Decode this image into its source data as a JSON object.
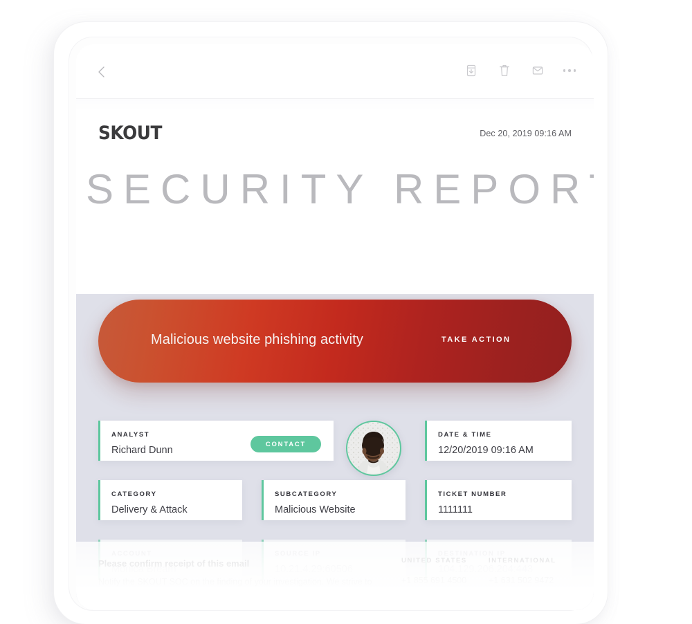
{
  "toolbar": {
    "back_icon": "chevron-left-icon",
    "actions": [
      {
        "icon": "archive-icon",
        "label": "Archive"
      },
      {
        "icon": "trash-icon",
        "label": "Delete"
      },
      {
        "icon": "envelope-icon",
        "label": "Mark as unread"
      },
      {
        "icon": "ellipsis-icon",
        "label": "More"
      }
    ]
  },
  "brand": {
    "logo_text": "SKOUT",
    "timestamp": "Dec 20, 2019 09:16 AM"
  },
  "report": {
    "title": "SECURITY REPORT"
  },
  "alert": {
    "message": "Malicious website phishing activity",
    "cta_label": "TAKE ACTION",
    "gradient_start": "#c65a3a",
    "gradient_mid": "#c32a1e",
    "gradient_end": "#93201f"
  },
  "accent": {
    "green": "#5ec79e",
    "page_background": "#dfe0e9"
  },
  "cards": {
    "analyst": {
      "label": "ANALYST",
      "value": "Richard Dunn",
      "button": "CONTACT"
    },
    "datetime": {
      "label": "DATE & TIME",
      "value": "12/20/2019  09:16 AM"
    },
    "category": {
      "label": "CATEGORY",
      "value": "Delivery & Attack"
    },
    "subcategory": {
      "label": "SUBCATEGORY",
      "value": "Malicious Website"
    },
    "ticket": {
      "label": "TICKET NUMBER",
      "value": "1111111"
    },
    "account": {
      "label": "ACCOUNT",
      "value": "Monica Bream"
    },
    "source_ip": {
      "label": "SOURCE IP",
      "value": "10.21.4.29:60506"
    },
    "destination_ip": {
      "label": "DESTINATION IP",
      "value": "104.129.206.204:443"
    }
  },
  "avatar": {
    "alt": "analyst-photo"
  },
  "footer": {
    "heading": "Please confirm receipt of this email",
    "paragraph": "Notify the SKOUT SOC on the finding of your investigation. We strive to improve our capability and identify false positives and to improve our detection capabilities.",
    "us": {
      "label": "UNITED STATES",
      "value": "+1 855 691 4500"
    },
    "intl": {
      "label": "INTERNATIONAL",
      "value": "+1 631 502 9472"
    }
  }
}
